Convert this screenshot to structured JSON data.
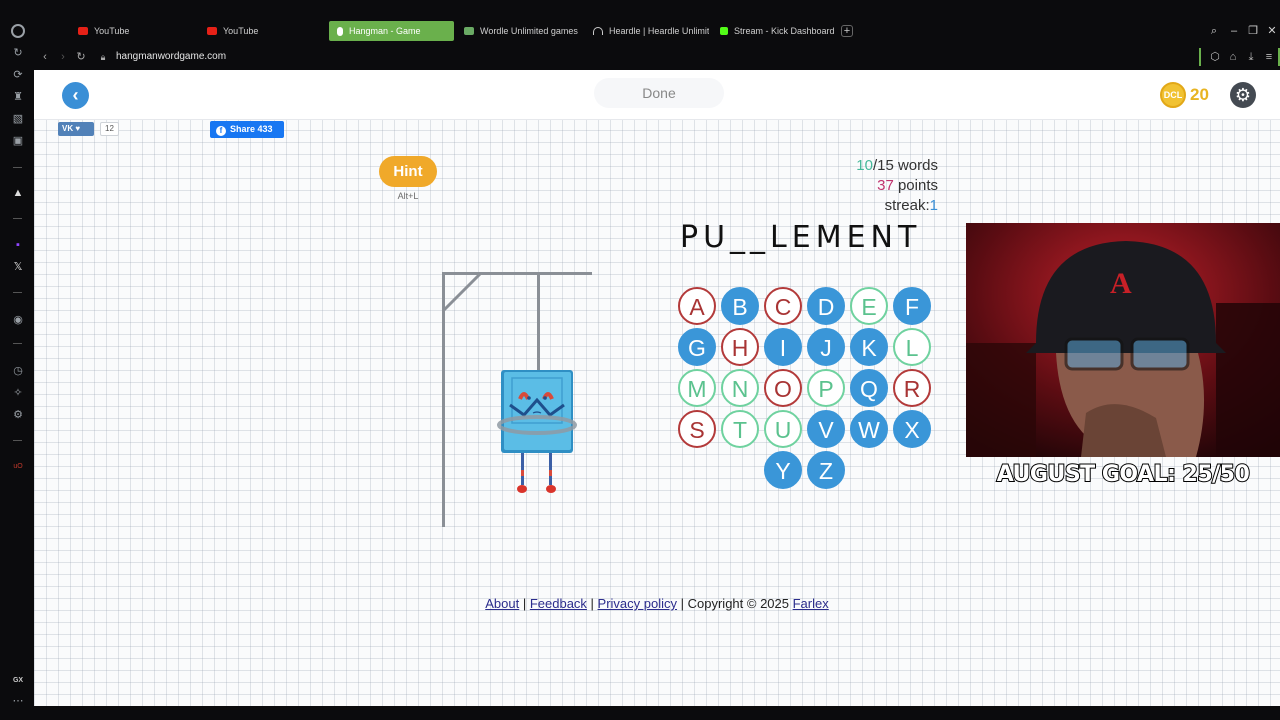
{
  "browser": {
    "tabs": [
      {
        "label": "YouTube",
        "active": false,
        "favicon_color": "#e62117"
      },
      {
        "label": "YouTube",
        "active": false,
        "favicon_color": "#e62117"
      },
      {
        "label": "Hangman - Game",
        "active": true,
        "favicon_color": "#ffffff"
      },
      {
        "label": "Wordle Unlimited games",
        "active": false,
        "favicon_color": "#6aaa64"
      },
      {
        "label": "Heardle | Heardle Unlimit",
        "active": false,
        "favicon_color": "#cccccc"
      },
      {
        "label": "Stream - Kick Dashboard",
        "active": false,
        "favicon_color": "#53fc18"
      }
    ],
    "new_tab_symbol": "+",
    "url": "hangmanwordgame.com",
    "sidebar_label": "GX"
  },
  "game": {
    "done_label": "Done",
    "coins": "20",
    "coin_icon_text": "DCL",
    "vk_label": "VK ♥",
    "vk_count": "12",
    "fb_share_label": "Share",
    "fb_share_count": "433",
    "hint_label": "Hint",
    "hint_shortcut": "Alt+L",
    "stats": {
      "words_done": "10",
      "words_total": "/15 words",
      "points_value": "37",
      "points_label": " points",
      "streak_label": "streak:",
      "streak_value": "1"
    },
    "word": "PU__LEMENT",
    "letters": [
      {
        "ch": "A",
        "state": "wrong"
      },
      {
        "ch": "B",
        "state": "available"
      },
      {
        "ch": "C",
        "state": "wrong"
      },
      {
        "ch": "D",
        "state": "available"
      },
      {
        "ch": "E",
        "state": "correct"
      },
      {
        "ch": "F",
        "state": "available"
      },
      {
        "ch": "G",
        "state": "available"
      },
      {
        "ch": "H",
        "state": "wrong"
      },
      {
        "ch": "I",
        "state": "available"
      },
      {
        "ch": "J",
        "state": "available"
      },
      {
        "ch": "K",
        "state": "available"
      },
      {
        "ch": "L",
        "state": "correct"
      },
      {
        "ch": "M",
        "state": "correct"
      },
      {
        "ch": "N",
        "state": "correct"
      },
      {
        "ch": "O",
        "state": "wrong"
      },
      {
        "ch": "P",
        "state": "correct"
      },
      {
        "ch": "Q",
        "state": "available"
      },
      {
        "ch": "R",
        "state": "wrong"
      },
      {
        "ch": "S",
        "state": "wrong"
      },
      {
        "ch": "T",
        "state": "correct"
      },
      {
        "ch": "U",
        "state": "correct"
      },
      {
        "ch": "V",
        "state": "available"
      },
      {
        "ch": "W",
        "state": "available"
      },
      {
        "ch": "X",
        "state": "available"
      },
      {
        "ch": "Y",
        "state": "available"
      },
      {
        "ch": "Z",
        "state": "available"
      }
    ]
  },
  "footer": {
    "about": "About",
    "sep": " | ",
    "feedback": "Feedback",
    "privacy": "Privacy policy",
    "copyright": "Copyright © 2025 ",
    "farlex": "Farlex"
  },
  "overlay": {
    "goal_text": "AUGUST GOAL: 25/50"
  },
  "colors": {
    "accent_blue": "#3a96d8",
    "correct_green": "#5bc28e",
    "wrong_red": "#b33a3a",
    "hint_orange": "#f0a92a",
    "coin_gold": "#e8b422"
  }
}
